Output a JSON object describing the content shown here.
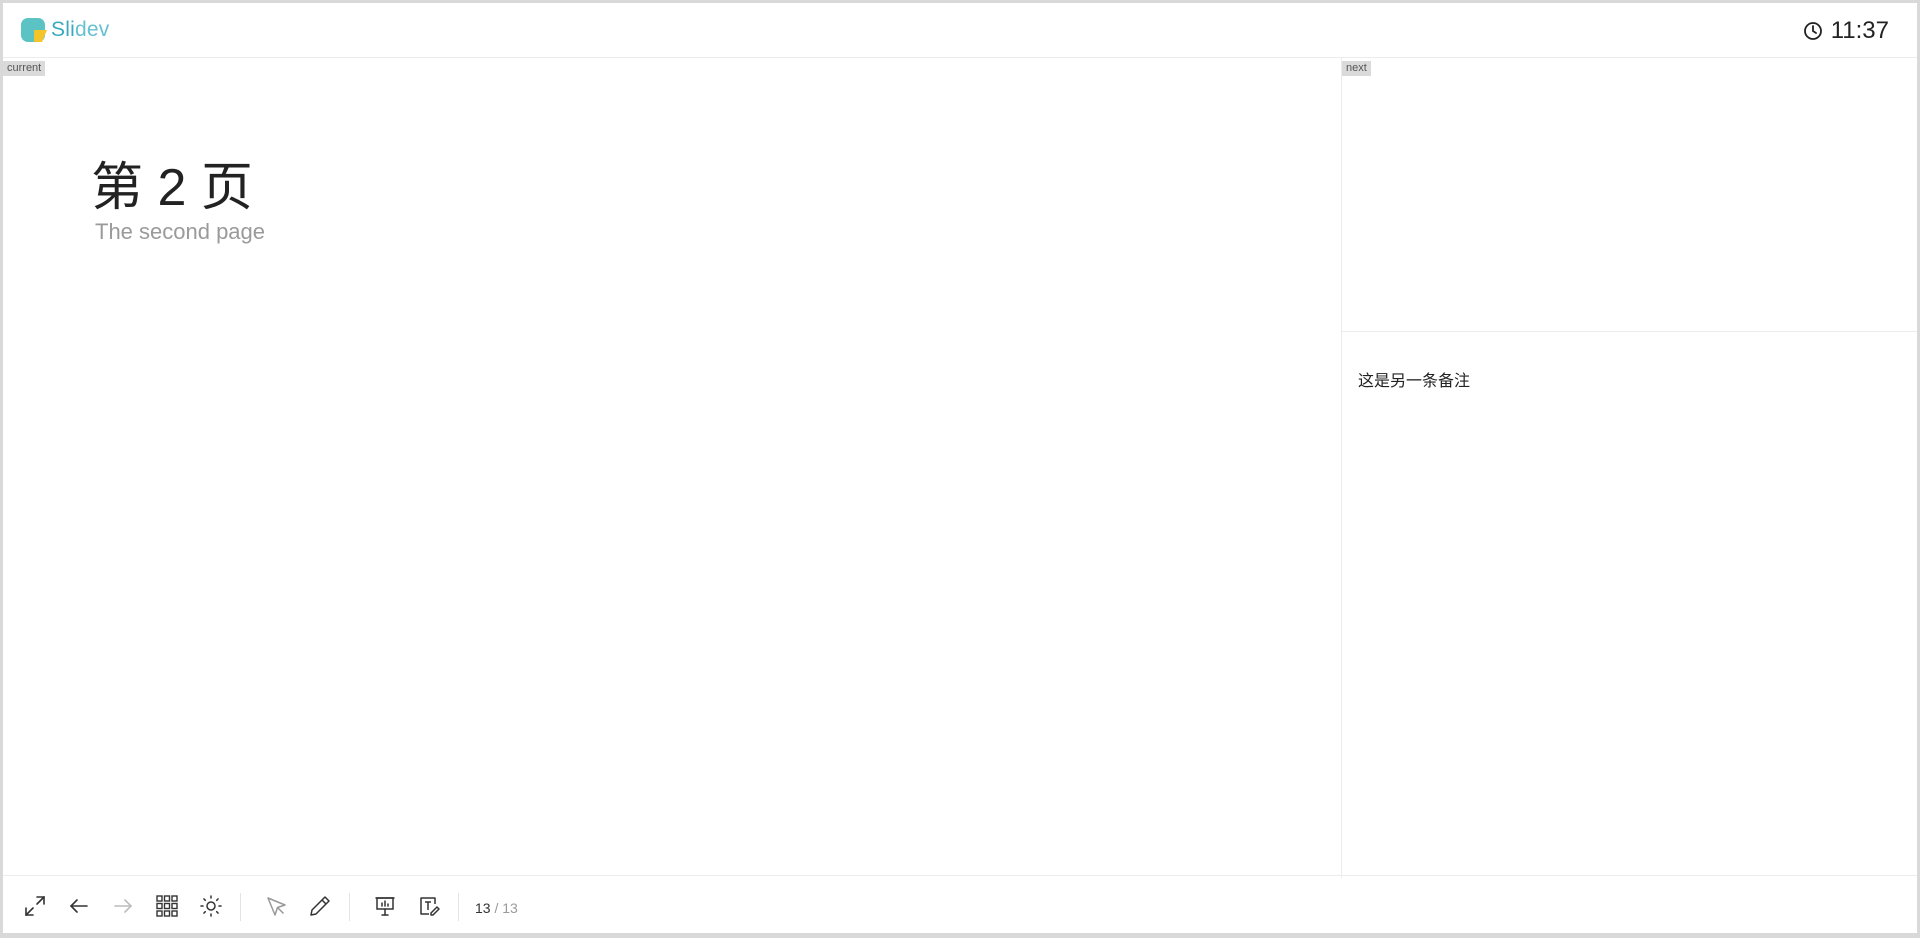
{
  "app": {
    "brand_left": "Sli",
    "brand_right": "dev"
  },
  "clock": {
    "time": "11:37"
  },
  "panels": {
    "current_label": "current",
    "next_label": "next"
  },
  "slide": {
    "title": "第 2 页",
    "subtitle": "The second page"
  },
  "notes": {
    "text": "这是另一条备注"
  },
  "pager": {
    "current": "13",
    "separator": " / ",
    "total": "13"
  },
  "toolbar": {
    "icons": [
      "expand-icon",
      "arrow-left-icon",
      "arrow-right-icon",
      "grid-icon",
      "sun-icon",
      "cursor-icon",
      "pen-icon",
      "presentation-icon",
      "edit-note-icon"
    ]
  }
}
